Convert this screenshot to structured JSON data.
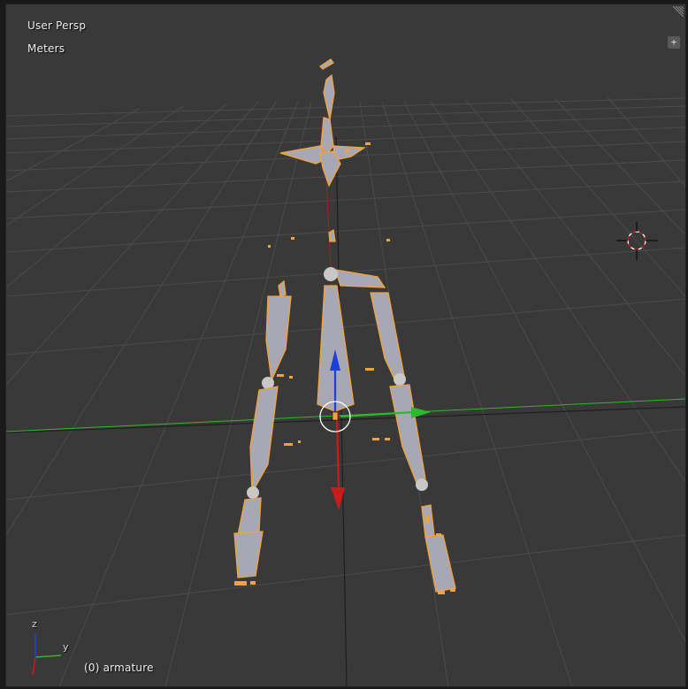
{
  "viewport": {
    "view_label": "User Persp",
    "units_label": "Meters",
    "object_label": "(0) armature",
    "axis_y_label": "y",
    "axis_z_label": "z"
  },
  "icons": {
    "plus": "+",
    "cursor": "3d-cursor-icon",
    "grip": "corner-grip-icon"
  },
  "colors": {
    "background": "#393939",
    "grid": "#4a4a4a",
    "x_axis": "#b51a1a",
    "y_axis": "#2eb82e",
    "z_axis": "#1f3fd9",
    "bone_fill": "#a8a8b4",
    "bone_outline": "#f2a33a",
    "joint": "#c8c8c8"
  }
}
